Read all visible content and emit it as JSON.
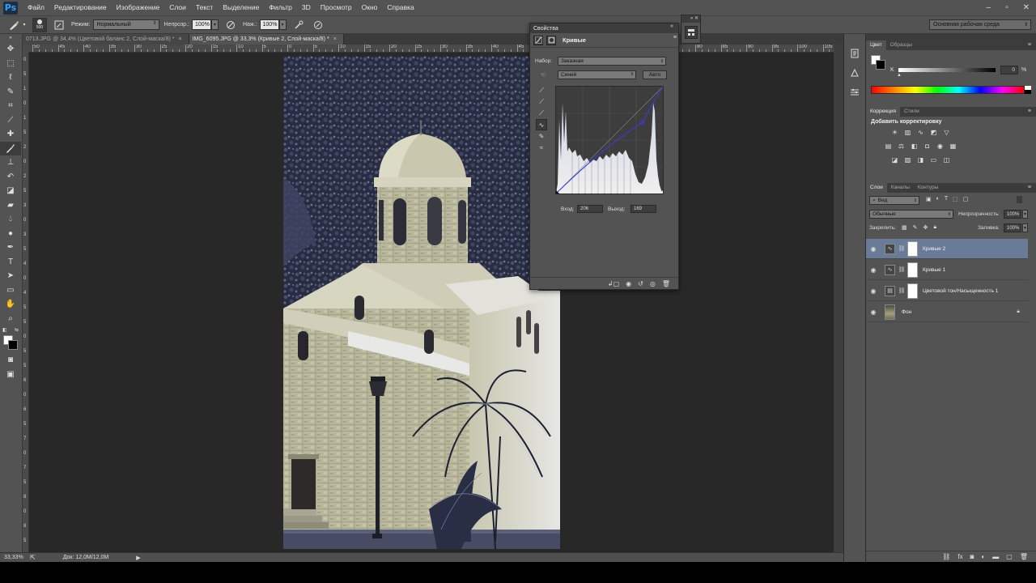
{
  "app": {
    "logo": "Ps"
  },
  "menu": [
    "Файл",
    "Редактирование",
    "Изображение",
    "Слои",
    "Текст",
    "Выделение",
    "Фильтр",
    "3D",
    "Просмотр",
    "Окно",
    "Справка"
  ],
  "window_controls": {
    "minimize": "–",
    "maximize": "▫",
    "close": "✕"
  },
  "options_bar": {
    "brush_size": "500",
    "mode_label": "Режим:",
    "mode_value": "Нормальный",
    "opacity_label": "Непрозр.:",
    "opacity_value": "100%",
    "flow_label": "Наж.:",
    "flow_value": "100%",
    "workspace": "Основная рабочая среда"
  },
  "tabs": [
    {
      "label": "0713.JPG @ 34,4% (Цветовой баланс 2, Слой-маска/8) *",
      "close": "×",
      "active": false
    },
    {
      "label": "IMG_6095.JPG @ 33,3% (Кривые 2, Слой-маска/8) *",
      "close": "×",
      "active": true
    }
  ],
  "ruler_top": [
    "50",
    "45",
    "40",
    "35",
    "30",
    "25",
    "20",
    "15",
    "10",
    "5",
    "0",
    "5",
    "10",
    "15",
    "20",
    "25",
    "30",
    "35",
    "40",
    "45",
    "50",
    "55",
    "60",
    "65",
    "70",
    "75",
    "80",
    "85",
    "90",
    "95",
    "100",
    "105"
  ],
  "ruler_left": [
    "0",
    "5",
    "1",
    "0",
    "1",
    "5",
    "2",
    "0",
    "2",
    "5",
    "3",
    "0",
    "3",
    "5",
    "4",
    "0",
    "4",
    "5",
    "5",
    "0",
    "5",
    "5",
    "6",
    "0",
    "6",
    "5",
    "7",
    "0",
    "7",
    "5",
    "8",
    "0",
    "8",
    "5"
  ],
  "status": {
    "zoom": "33,33%",
    "doc": "Док: 12,0M/12,0M",
    "arrow": "▶"
  },
  "properties": {
    "title": "Свойства",
    "collapse": "«",
    "menu_icon": "≡",
    "panel_title": "Кривые",
    "preset_label": "Набор:",
    "preset_value": "Заказная",
    "channel_value": "Синий",
    "auto_label": "Авто",
    "input_label": "Вход:",
    "input_value": "206",
    "output_label": "Выход:",
    "output_value": "169",
    "curve_color": "#3b3bd6"
  },
  "color_panel": {
    "tabs": [
      "Цвет",
      "Образцы"
    ],
    "k_label": "K",
    "k_value": "0",
    "k_unit": "%"
  },
  "adjustments_panel": {
    "tabs": [
      "Коррекция",
      "Стили"
    ],
    "heading": "Добавить корректировку"
  },
  "layers_panel": {
    "tabs": [
      "Слои",
      "Каналы",
      "Контуры"
    ],
    "filter_value": "Вид",
    "blend_mode": "Обычные",
    "opacity_label": "Непрозрачность:",
    "opacity_value": "100%",
    "lock_label": "Закрепить:",
    "fill_label": "Заливка:",
    "fill_value": "100%",
    "layers": [
      {
        "name": "Кривые 2",
        "type": "curves",
        "selected": true
      },
      {
        "name": "Кривые 1",
        "type": "curves",
        "selected": false
      },
      {
        "name": "Цветовой тон/Насыщенность 1",
        "type": "hue",
        "selected": false
      },
      {
        "name": "Фон",
        "type": "background",
        "selected": false
      }
    ]
  },
  "colors": {
    "selected_layer": "#6a7b98",
    "panel_bg": "#535353",
    "canvas_bg": "#282828"
  }
}
